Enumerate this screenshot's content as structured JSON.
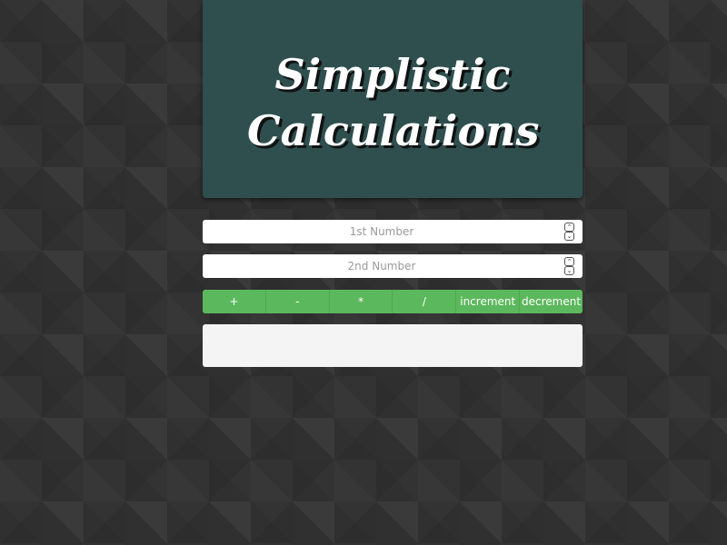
{
  "header": {
    "title": "Simplistic Calculations",
    "background_color": "#2f4f4f"
  },
  "inputs": {
    "first": {
      "placeholder": "1st Number",
      "value": ""
    },
    "second": {
      "placeholder": "2nd Number",
      "value": ""
    },
    "spinner_icons": {
      "up": "chevron-up-icon",
      "down": "chevron-down-icon"
    }
  },
  "operations": {
    "color": "#5cb85c",
    "items": [
      {
        "label": "+"
      },
      {
        "label": "-"
      },
      {
        "label": "*"
      },
      {
        "label": "/"
      },
      {
        "label": "increment"
      },
      {
        "label": "decrement"
      }
    ]
  },
  "result": {
    "text": ""
  }
}
